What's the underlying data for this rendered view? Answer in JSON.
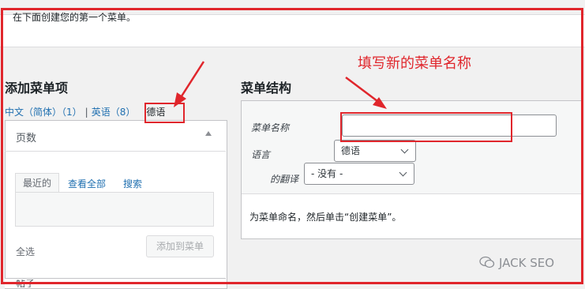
{
  "notice": {
    "text": "在下面创建您的第一个菜单。"
  },
  "left": {
    "title": "添加菜单项",
    "languages": [
      {
        "label": "中文（简体）（1）"
      },
      {
        "label": "英语（8）"
      }
    ],
    "current_language": "德语",
    "pages_panel": {
      "title": "页数",
      "tabs": [
        "最近的",
        "查看全部",
        "搜索"
      ],
      "select_all": "全选",
      "add_button": "添加到菜单",
      "next_panel_title": "帖子"
    }
  },
  "right": {
    "title": "菜单结构",
    "menu_name_label": "菜单名称",
    "menu_name_value": "",
    "language_label": "语言",
    "language_value": "德语",
    "translation_label": "的翻译",
    "translation_value": "- 没有 -",
    "hint": "为菜单命名，然后单击“创建菜单”。"
  },
  "annotation": {
    "text": "填写新的菜单名称",
    "color": "#e0262c"
  },
  "watermark": {
    "text": "JACK SEO"
  }
}
